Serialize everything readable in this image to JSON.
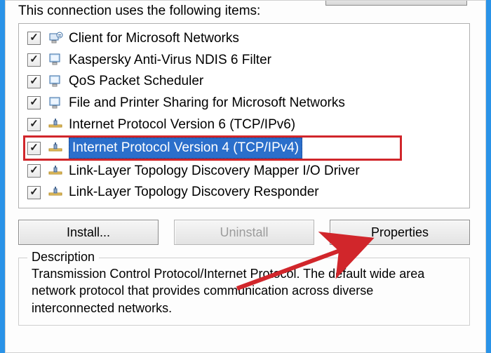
{
  "intro": "This connection uses the following items:",
  "items": [
    {
      "label": "Client for Microsoft Networks",
      "icon": "client",
      "checked": true,
      "selected": false
    },
    {
      "label": "Kaspersky Anti-Virus NDIS 6 Filter",
      "icon": "filter",
      "checked": true,
      "selected": false
    },
    {
      "label": "QoS Packet Scheduler",
      "icon": "sched",
      "checked": true,
      "selected": false
    },
    {
      "label": "File and Printer Sharing for Microsoft Networks",
      "icon": "share",
      "checked": true,
      "selected": false
    },
    {
      "label": "Internet Protocol Version 6 (TCP/IPv6)",
      "icon": "net",
      "checked": true,
      "selected": false
    },
    {
      "label": "Internet Protocol Version 4 (TCP/IPv4)",
      "icon": "net",
      "checked": true,
      "selected": true
    },
    {
      "label": "Link-Layer Topology Discovery Mapper I/O Driver",
      "icon": "net",
      "checked": true,
      "selected": false
    },
    {
      "label": "Link-Layer Topology Discovery Responder",
      "icon": "net",
      "checked": true,
      "selected": false
    }
  ],
  "buttons": {
    "install": "Install...",
    "uninstall": "Uninstall",
    "properties": "Properties"
  },
  "description": {
    "legend": "Description",
    "text": "Transmission Control Protocol/Internet Protocol. The default wide area network protocol that provides communication across diverse interconnected networks."
  }
}
